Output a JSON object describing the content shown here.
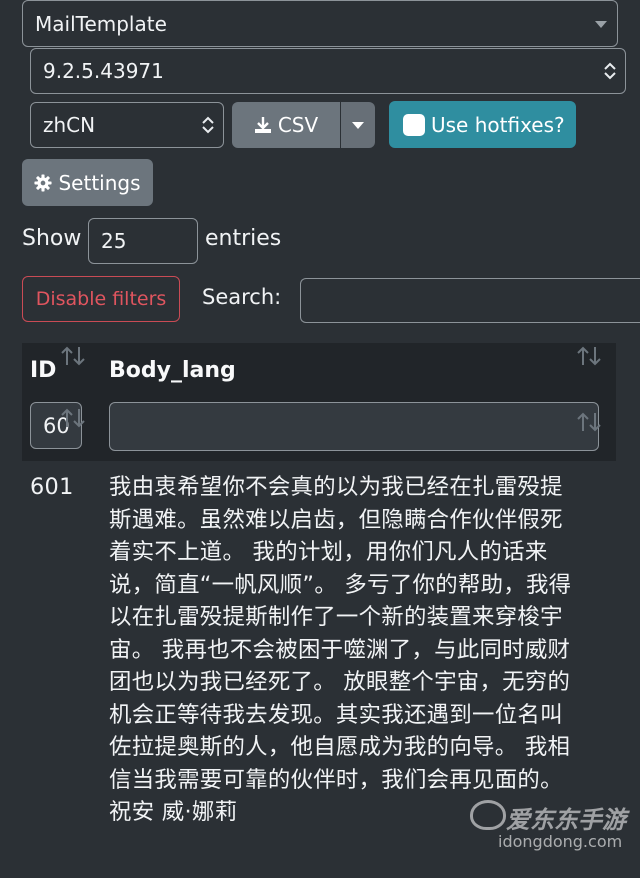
{
  "controls": {
    "template_select": "MailTemplate",
    "version_select": "9.2.5.43971",
    "locale_select": "zhCN",
    "csv_label": "CSV",
    "hotfixes_label": "Use hotfixes?",
    "settings_label": "Settings"
  },
  "length": {
    "show_label": "Show",
    "value": "25",
    "entries_label": "entries"
  },
  "filters": {
    "disable_label": "Disable filters",
    "search_label": "Search:",
    "search_value": ""
  },
  "table": {
    "headers": [
      "ID",
      "Body_lang"
    ],
    "filter_id_value": "60",
    "filter_body_value": "",
    "rows": [
      {
        "id": "601",
        "body_lines": [
          "我由衷希望你不会真的以为我已经在扎雷殁提",
          "斯遇难。虽然难以启齿，但隐瞒合作伙伴假死",
          "着实不上道。 我的计划，用你们凡人的话来",
          "说，简直“一帆风顺”。 多亏了你的帮助，我得",
          "以在扎雷殁提斯制作了一个新的装置来穿梭宇",
          "宙。 我再也不会被困于噬渊了，与此同时威财",
          "团也以为我已经死了。 放眼整个宇宙，无穷的",
          "机会正等待我去发现。其实我还遇到一位名叫",
          "佐拉提奥斯的人，他自愿成为我的向导。 我相",
          "信当我需要可靠的伙伴时，我们会再见面的。",
          "祝安 威·娜莉"
        ]
      }
    ]
  },
  "watermark": {
    "brand": "爱东东手游",
    "url": "idongdong.com"
  }
}
